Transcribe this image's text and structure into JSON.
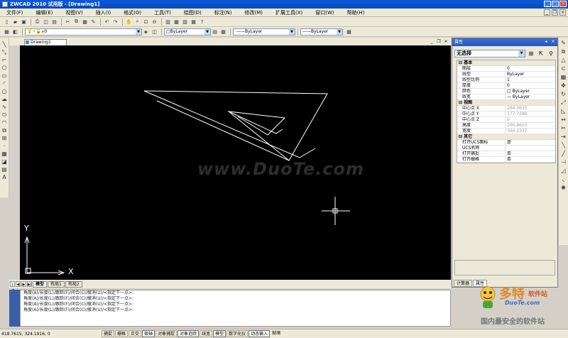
{
  "window": {
    "title": "ZWCAD 2010 试用版 - [Drawing1]"
  },
  "menu": [
    "文件(F)",
    "编辑(E)",
    "视图(V)",
    "插入(I)",
    "格式(O)",
    "工具(T)",
    "绘图(D)",
    "标注(N)",
    "修改(M)",
    "扩展工具(X)",
    "窗口(W)",
    "帮助(H)"
  ],
  "toolbar": {
    "layer_value": "0",
    "color_value": "ByLayer",
    "linetype_value": "ByLayer",
    "lineweight_value": "ByLayer"
  },
  "document": {
    "tab_label": "Drawing1"
  },
  "canvas": {
    "background": "#000000",
    "ucs_x_label": "X",
    "ucs_y_label": "Y",
    "watermark": "www.DuoTe.com"
  },
  "layout_tabs": [
    "模型",
    "布局1",
    "布局2"
  ],
  "command_lines": [
    "角度(A)/长度(L)/跟踪(F)/闭合(C)/撤消(U)/<指定下一点>:",
    "角度(A)/长度(L)/跟踪(F)/闭合(C)/撤消(U)/<指定下一点>:",
    "角度(A)/长度(L)/跟踪(F)/闭合(C)/撤消(U)/<指定下一点>:",
    "角度(A)/长度(L)/跟踪(F)/闭合(C)/撤消(U)/<指定下一点>:"
  ],
  "status": {
    "coords": "418.7615, 324.1916, 0",
    "buttons": [
      {
        "label": "捕捉",
        "on": false
      },
      {
        "label": "栅格",
        "on": false
      },
      {
        "label": "正交",
        "on": false
      },
      {
        "label": "极轴",
        "on": true
      },
      {
        "label": "对象捕捉",
        "on": false
      },
      {
        "label": "对象追踪",
        "on": true
      },
      {
        "label": "线宽",
        "on": false
      },
      {
        "label": "模型",
        "on": true
      },
      {
        "label": "数字化仪",
        "on": false
      },
      {
        "label": "动态输入",
        "on": true
      },
      {
        "label": "就绪",
        "on": false
      }
    ]
  },
  "properties": {
    "title": "属性",
    "selection": "无选择",
    "categories": [
      {
        "name": "基本",
        "rows": [
          {
            "name": "图层",
            "value": "0",
            "grey": false
          },
          {
            "name": "线型",
            "value": "ByLayer",
            "grey": false
          },
          {
            "name": "线型比例",
            "value": "1",
            "grey": false
          },
          {
            "name": "厚度",
            "value": "0",
            "grey": false
          },
          {
            "name": "颜色",
            "value": "ByLayer",
            "grey": false
          },
          {
            "name": "线宽",
            "value": "— ByLayer",
            "grey": false
          }
        ]
      },
      {
        "name": "视图",
        "rows": [
          {
            "name": "中心点 X",
            "value": "264.0635",
            "grey": true
          },
          {
            "name": "中心点 Y",
            "value": "177.7286",
            "grey": true
          },
          {
            "name": "中心点 Z",
            "value": "0",
            "grey": true
          },
          {
            "name": "高度",
            "value": "200.9653",
            "grey": true
          },
          {
            "name": "宽度",
            "value": "364.2337",
            "grey": true
          }
        ]
      },
      {
        "name": "其它",
        "rows": [
          {
            "name": "打开UCS图标",
            "value": "是",
            "grey": false
          },
          {
            "name": "UCS名称",
            "value": "",
            "grey": false
          },
          {
            "name": "打开捕捉",
            "value": "否",
            "grey": false
          },
          {
            "name": "打开栅格",
            "value": "否",
            "grey": false
          }
        ]
      }
    ],
    "tabs": [
      "计算器",
      "属性"
    ]
  },
  "site_logo": {
    "line1": "多特",
    "line1b": "软件站",
    "line2": "DuoTe.com",
    "line3": "国内最安全的软件站"
  }
}
